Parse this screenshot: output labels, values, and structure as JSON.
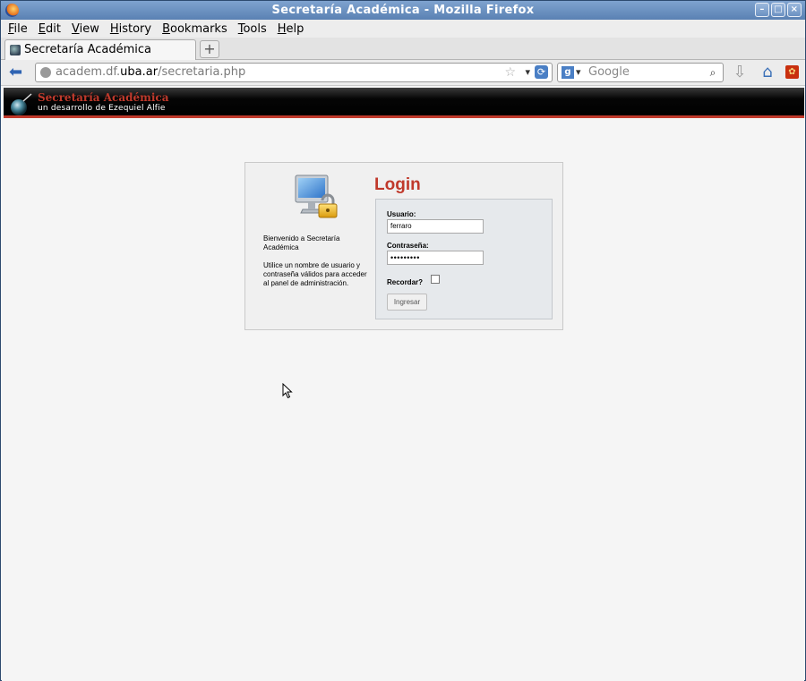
{
  "window": {
    "title": "Secretaría Académica - Mozilla Firefox"
  },
  "menubar": {
    "items": [
      {
        "label": "File"
      },
      {
        "label": "Edit"
      },
      {
        "label": "View"
      },
      {
        "label": "History"
      },
      {
        "label": "Bookmarks"
      },
      {
        "label": "Tools"
      },
      {
        "label": "Help"
      }
    ]
  },
  "tabs": [
    {
      "label": "Secretaría Académica"
    }
  ],
  "navbar": {
    "url_prefix": "academ.df.",
    "url_host": "uba.ar",
    "url_path": "/secretaria.php",
    "search_placeholder": "Google",
    "search_engine_letter": "g"
  },
  "site": {
    "title": "Secretaría Académica",
    "subtitle": "un desarrollo de Ezequiel Alfie"
  },
  "login": {
    "title": "Login",
    "welcome": "Bienvenido a Secretaría Académica",
    "instructions": "Utilice un nombre de usuario y contraseña válidos para acceder al panel de administración.",
    "username_label": "Usuario:",
    "username_value": "ferraro",
    "password_label": "Contraseña:",
    "password_value": "•••••••••",
    "remember_label": "Recordar?",
    "remember_checked": false,
    "submit_label": "Ingresar"
  },
  "colors": {
    "accent_red": "#c0392b",
    "titlebar_blue": "#5a81b3",
    "link_blue": "#2f64b3"
  }
}
